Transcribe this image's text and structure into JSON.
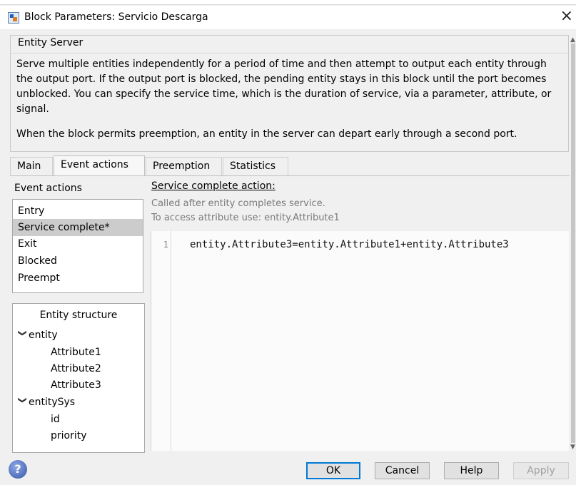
{
  "window": {
    "title": "Block Parameters: Servicio Descarga",
    "close_glyph": "×"
  },
  "block": {
    "name": "Entity Server",
    "description": "Serve multiple entities independently for a period of time and then attempt to output each entity through the output port. If the output port is blocked, the pending entity stays in this block until the port becomes unblocked. You can specify the service time, which is the duration of service, via a parameter, attribute, or signal.",
    "preemption_note": "When the block permits preemption, an entity in the server can depart early through a second port."
  },
  "tabs": [
    {
      "label": "Main"
    },
    {
      "label": "Event actions",
      "active": true
    },
    {
      "label": "Preemption"
    },
    {
      "label": "Statistics"
    }
  ],
  "event_actions": {
    "label": "Event actions",
    "items": [
      {
        "label": "Entry"
      },
      {
        "label": "Service complete*",
        "selected": true
      },
      {
        "label": "Exit"
      },
      {
        "label": "Blocked"
      },
      {
        "label": "Preempt"
      }
    ]
  },
  "entity_structure": {
    "title": "Entity structure",
    "rows": [
      {
        "label": "entity",
        "expandable": true
      },
      {
        "label": "Attribute1"
      },
      {
        "label": "Attribute2"
      },
      {
        "label": "Attribute3"
      },
      {
        "label": "entitySys",
        "expandable": true
      },
      {
        "label": "id"
      },
      {
        "label": "priority"
      }
    ]
  },
  "action_editor": {
    "label": "Service complete action:",
    "help_line1": "Called after entity completes service.",
    "help_line2": "To access attribute use: entity.Attribute1",
    "line_number": "1",
    "code": "entity.Attribute3=entity.Attribute1+entity.Attribute3"
  },
  "buttons": {
    "ok": "OK",
    "cancel": "Cancel",
    "help": "Help",
    "apply": "Apply"
  },
  "icons": {
    "help": "?",
    "chevron": "❯"
  }
}
